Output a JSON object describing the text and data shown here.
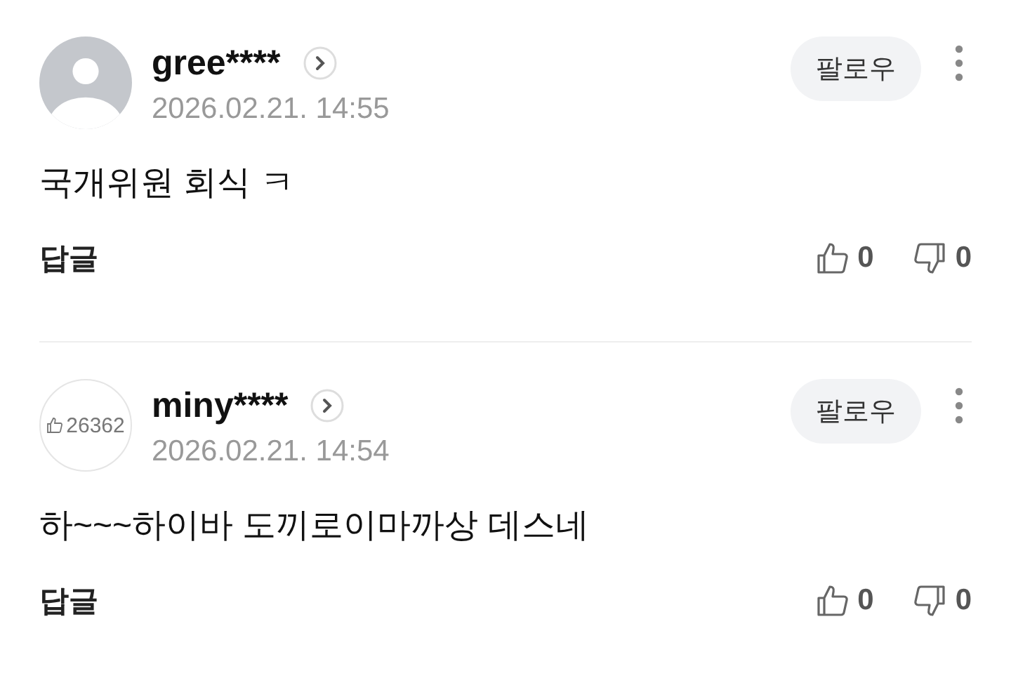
{
  "comments": [
    {
      "avatar": {
        "kind": "default"
      },
      "username": "gree****",
      "date": "2026.02.21. 14:55",
      "follow": "팔로우",
      "text": "국개위원 회식 ㅋ",
      "reply": "답글",
      "likes": "0",
      "dislikes": "0"
    },
    {
      "avatar": {
        "kind": "likes",
        "count": "26362"
      },
      "username": "miny****",
      "date": "2026.02.21. 14:54",
      "follow": "팔로우",
      "text": "하~~~하이바 도끼로이마까상 데스네",
      "reply": "답글",
      "likes": "0",
      "dislikes": "0"
    }
  ]
}
